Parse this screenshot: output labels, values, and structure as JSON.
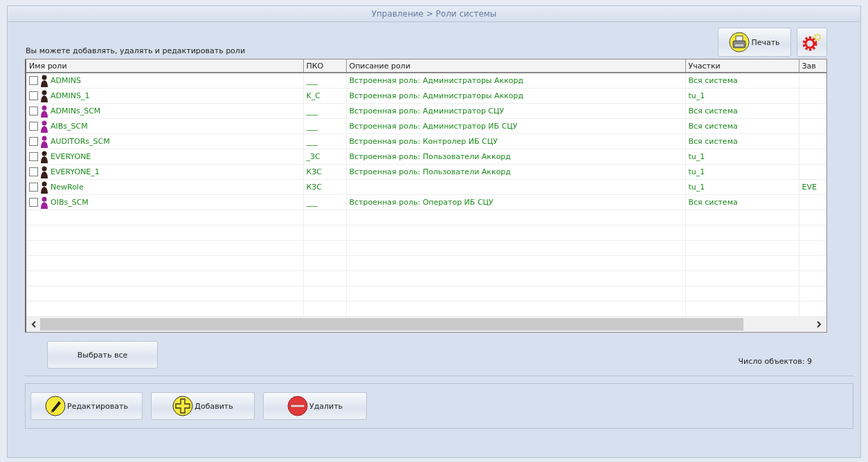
{
  "breadcrumb": "Управление > Роли системы",
  "print_button": {
    "label": "Печать"
  },
  "hint": "Вы можете добавлять, удалять и редактировать роли",
  "table": {
    "columns": [
      "Имя роли",
      "ПКО",
      "Описание роли",
      "Участки",
      "Зав"
    ],
    "rows": [
      {
        "checked": false,
        "color": "#3a1e18",
        "name": "ADMINS",
        "pko": "___",
        "description": "Встроенная роль: Администраторы Аккорд",
        "areas": "Вся система",
        "column_5": ""
      },
      {
        "checked": false,
        "color": "#3a1e18",
        "name": "ADMINS_1",
        "pko": "K_C",
        "description": "Встроенная роль: Администраторы Аккорд",
        "areas": "tu_1",
        "column_5": ""
      },
      {
        "checked": false,
        "color": "#a0209a",
        "name": "ADMINs_SCM",
        "pko": "___",
        "description": "Встроенная роль: Администратор СЦУ",
        "areas": "Вся система",
        "column_5": ""
      },
      {
        "checked": false,
        "color": "#a0209a",
        "name": "AIBs_SCM",
        "pko": "___",
        "description": "Встроенная роль: Администратор ИБ СЦУ",
        "areas": "Вся система",
        "column_5": ""
      },
      {
        "checked": false,
        "color": "#a0209a",
        "name": "AUDITORs_SCM",
        "pko": "___",
        "description": "Встроенная роль: Контролер ИБ СЦУ",
        "areas": "Вся система",
        "column_5": ""
      },
      {
        "checked": false,
        "color": "#3a1e18",
        "name": "EVERYONE",
        "pko": "_ЗС",
        "description": "Встроенная роль: Пользователи Аккорд",
        "areas": "tu_1",
        "column_5": ""
      },
      {
        "checked": false,
        "color": "#3a1e18",
        "name": "EVERYONE_1",
        "pko": "КЗС",
        "description": "Встроенная роль: Пользователи Аккорд",
        "areas": "tu_1",
        "column_5": ""
      },
      {
        "checked": false,
        "color": "#3a1e18",
        "name": "NewRole",
        "pko": "КЗС",
        "description": "",
        "areas": "tu_1",
        "column_5": "EVE"
      },
      {
        "checked": false,
        "color": "#a0209a",
        "name": "OIBs_SCM",
        "pko": "___",
        "description": "Встроенная роль: Оператор ИБ СЦУ",
        "areas": "Вся система",
        "column_5": ""
      }
    ]
  },
  "select_all_button": "Выбрать все",
  "object_count": "Число объектов: 9",
  "actions": [
    {
      "kind": "edit",
      "label": "Редактировать"
    },
    {
      "kind": "add",
      "label": "Добавить"
    },
    {
      "kind": "delete",
      "label": "Удалить"
    }
  ]
}
